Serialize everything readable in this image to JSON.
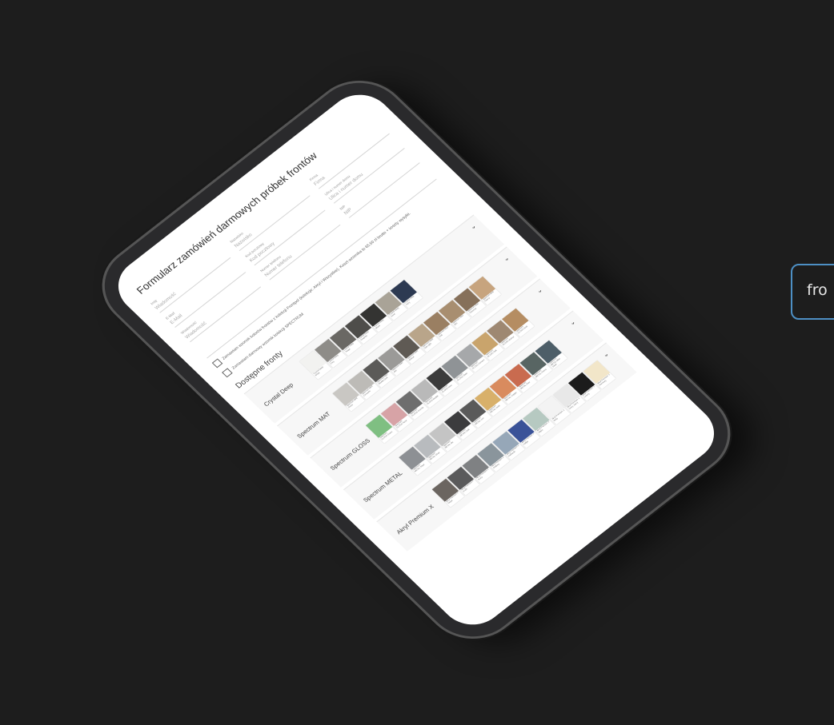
{
  "form": {
    "title": "Formularz zamówień darmowych próbek frontów",
    "fields": [
      {
        "label": "Imię",
        "placeholder": "Wiadomość"
      },
      {
        "label": "Nazwisko",
        "placeholder": "Nazwisko"
      },
      {
        "label": "Firma",
        "placeholder": "Firma"
      },
      {
        "label": "E-Mail",
        "placeholder": "E-Mail"
      },
      {
        "label": "Kod pocztowy",
        "placeholder": "Kod pocztowy"
      },
      {
        "label": "Ulica i numer domu",
        "placeholder": "Ulica i numer domu"
      },
      {
        "label": "Wiadomość",
        "placeholder": "Wiadomość"
      },
      {
        "label": "Numer telefonu",
        "placeholder": "Numer telefonu"
      },
      {
        "label": "NIP",
        "placeholder": "NIP"
      }
    ],
    "checkbox1": "Zamawiam wzornik kolorów frontów z kolekcji Frontpol (kolekcje: Akryl i Wszystkie). Koszt wzornika to 65,50 zł brutto + koszty wysyłki.",
    "checkbox2": "Zamawiam darmowy wzornik kolekcji SPECTRUM"
  },
  "section_title": "Dostępne fronty",
  "collections": [
    {
      "name": "Crystal Deep",
      "swatches": [
        {
          "color": "#f2f2f0",
          "label": "Crystal Deep White"
        },
        {
          "color": "#8e8c88",
          "label": "Crystal Deep Grey"
        },
        {
          "color": "#6a6864",
          "label": "Crystal Deep Taupe"
        },
        {
          "color": "#4e4d4a",
          "label": "Crystal Deep Graphite"
        },
        {
          "color": "#343432",
          "label": "Crystal Deep Black"
        },
        {
          "color": "#a9a397",
          "label": "Crystal Deep Sand"
        },
        {
          "color": "#2d3a52",
          "label": "Crystal Deep Navy"
        }
      ]
    },
    {
      "name": "Spectrum MAT",
      "swatches": [
        {
          "color": "#c9c7c3",
          "label": "Spectrum MAT Stone"
        },
        {
          "color": "#bdbbb7",
          "label": "Spectrum MAT Concrete"
        },
        {
          "color": "#5b5a58",
          "label": "Spectrum MAT Marble Dark"
        },
        {
          "color": "#9b9a98",
          "label": "Spectrum MAT Ash"
        },
        {
          "color": "#5f5a54",
          "label": "Spectrum MAT Walnut"
        },
        {
          "color": "#b9a58a",
          "label": "Spectrum MAT Oak Light"
        },
        {
          "color": "#9a7f62",
          "label": "Spectrum MAT Oak"
        },
        {
          "color": "#a88e70",
          "label": "Spectrum MAT Elm"
        },
        {
          "color": "#86705a",
          "label": "Spectrum MAT Chestnut"
        },
        {
          "color": "#c7a47e",
          "label": "Spectrum MAT Cherry"
        }
      ]
    },
    {
      "name": "Spectrum GLOSS",
      "swatches": [
        {
          "color": "#7fbf82",
          "label": "Spectrum GLOSS Green"
        },
        {
          "color": "#d7a3a6",
          "label": "Spectrum GLOSS Rose"
        },
        {
          "color": "#6e6e6e",
          "label": "Spectrum GLOSS Granite"
        },
        {
          "color": "#b9b9b9",
          "label": "Spectrum GLOSS Marble"
        },
        {
          "color": "#3b3b3b",
          "label": "Spectrum GLOSS Nero"
        },
        {
          "color": "#8f9396",
          "label": "Spectrum GLOSS Slate"
        },
        {
          "color": "#a6a8aa",
          "label": "Spectrum GLOSS Cement"
        },
        {
          "color": "#c9a46c",
          "label": "Spectrum GLOSS Oak"
        },
        {
          "color": "#9e8872",
          "label": "Spectrum GLOSS Walnut"
        },
        {
          "color": "#b58d62",
          "label": "Spectrum GLOSS Teak"
        }
      ]
    },
    {
      "name": "Spectrum METAL",
      "swatches": [
        {
          "color": "#8d9094",
          "label": "Spectrum METAL Steel"
        },
        {
          "color": "#b8bbbe",
          "label": "Spectrum METAL Silver"
        },
        {
          "color": "#c4c4c4",
          "label": "Spectrum METAL Alu"
        },
        {
          "color": "#3c3c3e",
          "label": "Spectrum METAL Dark"
        },
        {
          "color": "#5a5a5a",
          "label": "Spectrum METAL Iron"
        },
        {
          "color": "#d8b06a",
          "label": "Spectrum METAL Gold"
        },
        {
          "color": "#d98b5e",
          "label": "Spectrum METAL Copper"
        },
        {
          "color": "#c96b4f",
          "label": "Spectrum METAL Rust"
        },
        {
          "color": "#586563",
          "label": "Spectrum METAL Patina"
        },
        {
          "color": "#4d5e68",
          "label": "Spectrum METAL Blue Steel"
        }
      ]
    },
    {
      "name": "Akryl Premium X",
      "swatches": [
        {
          "color": "#6b6560",
          "label": "Akryl Premium X Taupe"
        },
        {
          "color": "#5a5a5b",
          "label": "Akryl Premium X Grafit"
        },
        {
          "color": "#7f8183",
          "label": "Akryl Premium X Szary"
        },
        {
          "color": "#8a959c",
          "label": "Akryl Premium X Stalowy"
        },
        {
          "color": "#96a7b8",
          "label": "Akryl Premium X Niebieski"
        },
        {
          "color": "#3a5298",
          "label": "Akryl Premium X Indigo"
        },
        {
          "color": "#b6c9c1",
          "label": "Akryl Premium X Mięta"
        },
        {
          "color": "#f3f3f3",
          "label": "Akryl Premium X Biały"
        },
        {
          "color": "#e8e8e8",
          "label": "Akryl Premium X Szary Jasny"
        },
        {
          "color": "#1c1c1c",
          "label": "Akryl Premium X Czarny"
        },
        {
          "color": "#f2e6c9",
          "label": "Akryl Premium X Kremowy"
        }
      ]
    }
  ],
  "side_button": "fro"
}
